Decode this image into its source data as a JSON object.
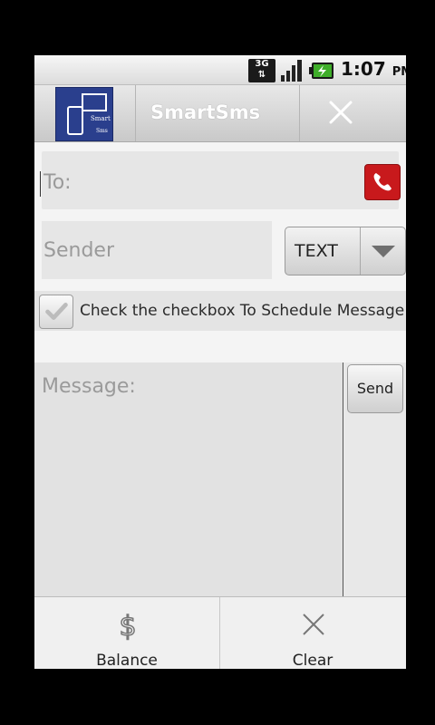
{
  "status_bar": {
    "network": "3G",
    "time": "1:07",
    "ampm": "PM"
  },
  "app": {
    "title": "SmartSms",
    "logo_text_1": "Smart",
    "logo_text_2": "Sms"
  },
  "form": {
    "to_placeholder": "To:",
    "to_value": "",
    "sender_placeholder": "Sender",
    "sender_value": "",
    "message_type": "TEXT",
    "schedule_label": "Check the checkbox To Schedule Message",
    "schedule_checked": false,
    "message_placeholder": "Message:",
    "send_label": "Send"
  },
  "menu": {
    "items": [
      {
        "label": "Balance",
        "icon": "dollar-icon"
      },
      {
        "label": "Clear",
        "icon": "close-icon"
      }
    ]
  },
  "colors": {
    "call_button": "#c8191c",
    "logo_bg": "#2a3f8d"
  }
}
